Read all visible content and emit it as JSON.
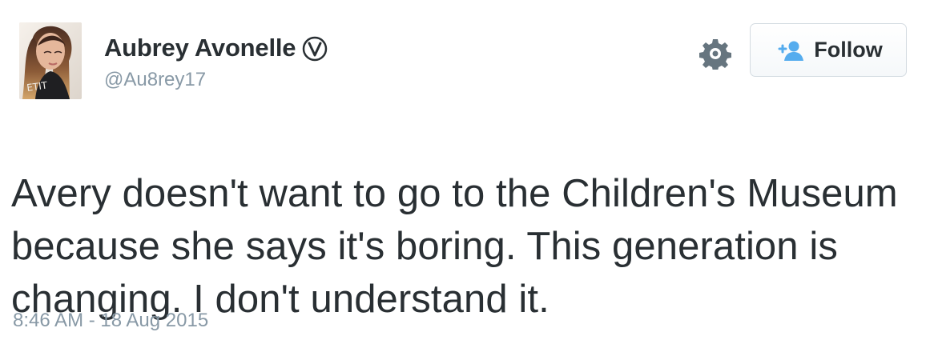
{
  "profile": {
    "display_name": "Aubrey Avonelle",
    "handle": "@Au8rey17",
    "avatar_text": "ETIT"
  },
  "actions": {
    "follow_label": "Follow",
    "gear_icon": "gear-icon",
    "follow_icon": "follow-person-icon"
  },
  "tweet": {
    "text": "Avery doesn't want to go to the Children's Museum because she says it's boring. This generation is changing. I don't understand it.",
    "timestamp": "8:46 AM - 18 Aug 2015"
  },
  "colors": {
    "text": "#292f33",
    "muted": "#8899a6",
    "accent": "#55acee",
    "border": "#d4dbe1"
  }
}
